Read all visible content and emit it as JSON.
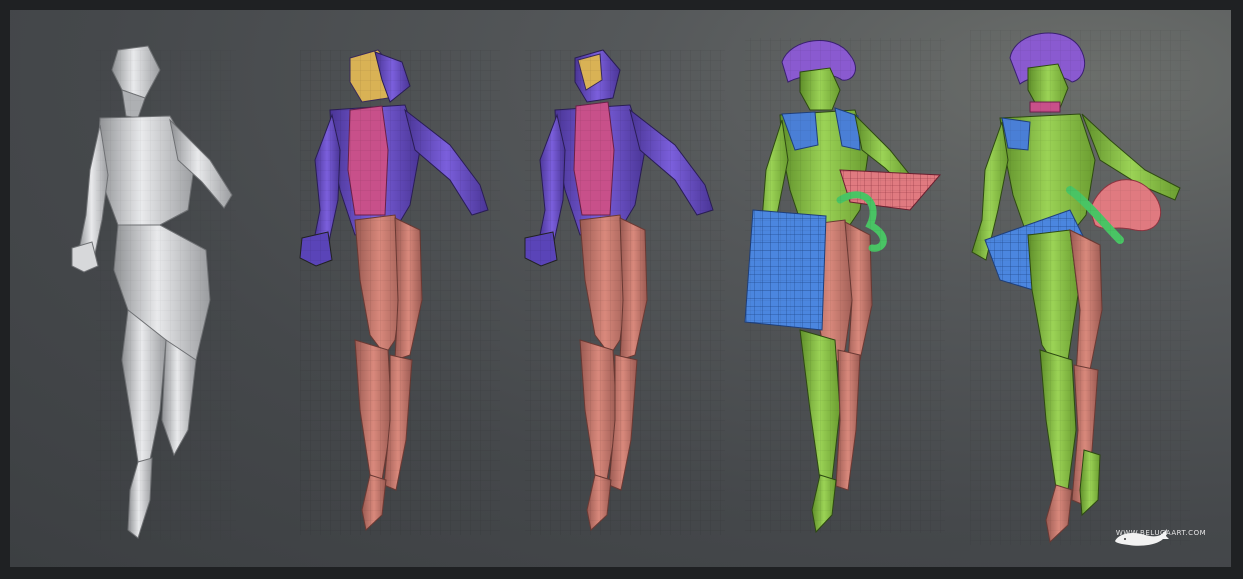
{
  "image": {
    "description_stages": [
      "blockout-grey",
      "base-color-zones",
      "refined-color-zones",
      "clothing-and-hair-added",
      "final-mesh"
    ]
  },
  "colors": {
    "background_light": "#6b6e6b",
    "background_dark": "#3c3f42",
    "frame": "#1f2123",
    "grey_model": "#c9cacc",
    "purple_torso": "#6a4fc7",
    "pink_torso": "#c8508a",
    "salmon_legs": "#c9786c",
    "yellow_head": "#d9b255",
    "green_skin": "#8fc64a",
    "hair_purple": "#8a5ad0",
    "cloth_blue": "#4a7fd6",
    "cloth_red": "#d86a73",
    "ribbon_green": "#49c464"
  },
  "watermark": {
    "text": "WWW.BELUGAART.COM",
    "icon": "whale-icon"
  }
}
